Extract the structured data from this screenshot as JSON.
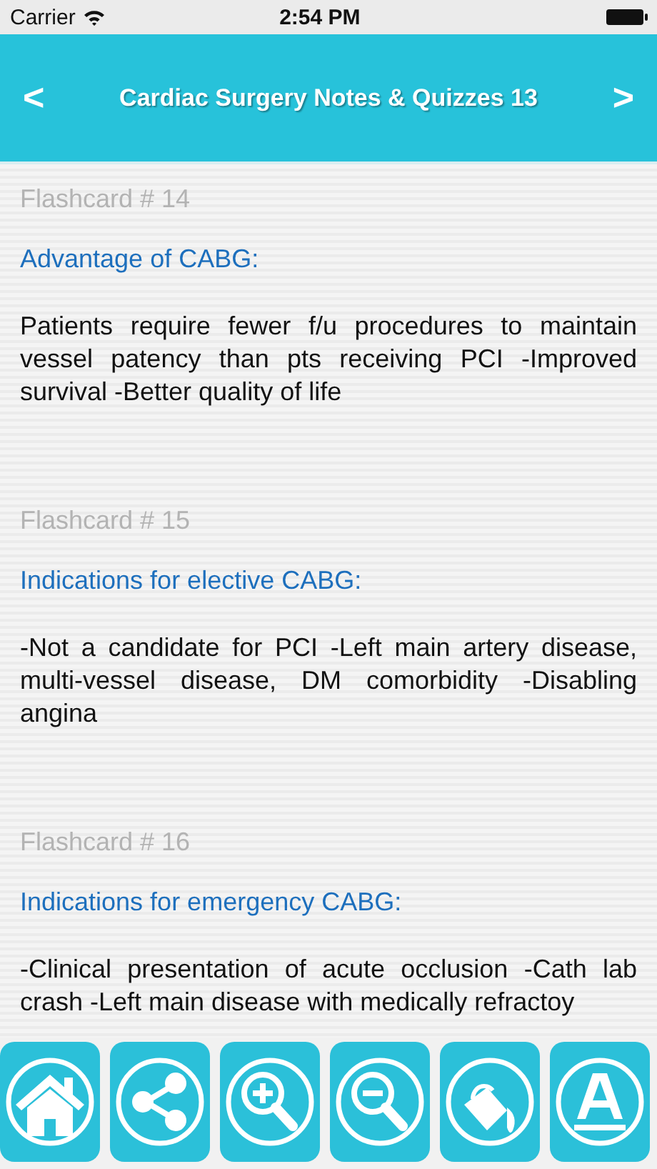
{
  "status_bar": {
    "carrier": "Carrier",
    "time": "2:54 PM"
  },
  "header": {
    "back": "<",
    "title": "Cardiac Surgery Notes & Quizzes 13",
    "forward": ">"
  },
  "cards": [
    {
      "label": "Flashcard # 14",
      "question": "Advantage of CABG:",
      "answer": "Patients require fewer f/u procedures to maintain vessel patency than pts receiving PCI -Improved survival -Better quality of life"
    },
    {
      "label": "Flashcard # 15",
      "question": "Indications for elective CABG:",
      "answer": "-Not a candidate for PCI -Left main artery disease, multi-vessel disease, DM comorbidity -Disabling angina"
    },
    {
      "label": "Flashcard # 16",
      "question": "Indications for emergency CABG:",
      "answer": "-Clinical presentation of acute occlusion -Cath lab crash -Left main disease with medically refractoy"
    }
  ],
  "toolbar": [
    {
      "kind": "home"
    },
    {
      "kind": "share"
    },
    {
      "kind": "zoom-in"
    },
    {
      "kind": "zoom-out"
    },
    {
      "kind": "paint"
    },
    {
      "kind": "font"
    }
  ]
}
